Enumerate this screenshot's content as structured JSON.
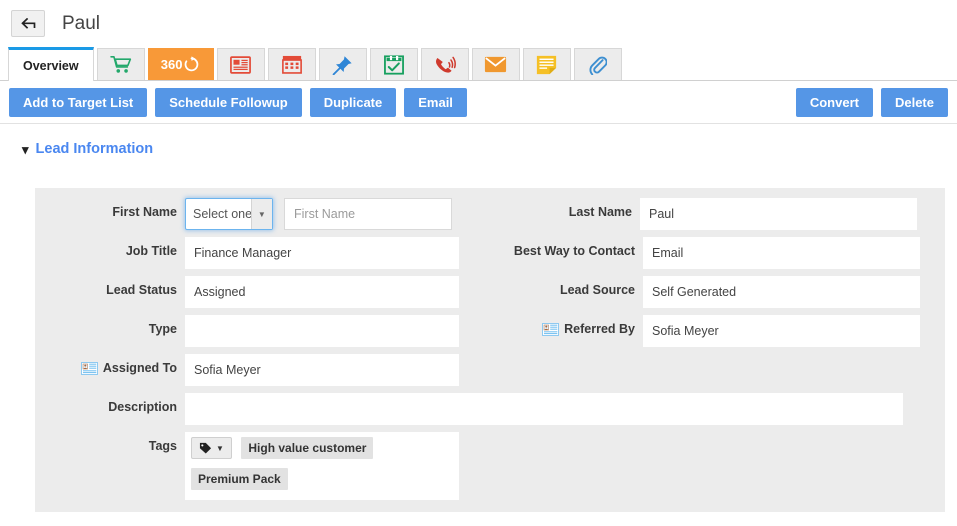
{
  "header": {
    "back_icon": "arrow-left-icon",
    "title": "Paul"
  },
  "tabs": [
    {
      "id": "overview",
      "label": "Overview",
      "icon": null,
      "active": true,
      "style": "text"
    },
    {
      "id": "cart",
      "label": "",
      "icon": "cart-icon",
      "active": false,
      "style": "icon"
    },
    {
      "id": "360",
      "label": "360",
      "icon": "refresh-360-icon",
      "active": false,
      "style": "orange"
    },
    {
      "id": "news",
      "label": "",
      "icon": "newspaper-icon",
      "active": false,
      "style": "icon"
    },
    {
      "id": "calendar",
      "label": "",
      "icon": "calendar-icon",
      "active": false,
      "style": "icon"
    },
    {
      "id": "pin",
      "label": "",
      "icon": "pushpin-icon",
      "active": false,
      "style": "icon"
    },
    {
      "id": "tasks",
      "label": "",
      "icon": "checklist-icon",
      "active": false,
      "style": "icon"
    },
    {
      "id": "calls",
      "label": "",
      "icon": "phone-icon",
      "active": false,
      "style": "icon"
    },
    {
      "id": "emails",
      "label": "",
      "icon": "envelope-icon",
      "active": false,
      "style": "icon"
    },
    {
      "id": "notes",
      "label": "",
      "icon": "note-icon",
      "active": false,
      "style": "icon"
    },
    {
      "id": "attachments",
      "label": "",
      "icon": "paperclip-icon",
      "active": false,
      "style": "icon"
    }
  ],
  "actions": {
    "left": [
      {
        "id": "add-to-target-list",
        "label": "Add to Target List"
      },
      {
        "id": "schedule-followup",
        "label": "Schedule Followup"
      },
      {
        "id": "duplicate",
        "label": "Duplicate"
      },
      {
        "id": "email",
        "label": "Email"
      }
    ],
    "right": [
      {
        "id": "convert",
        "label": "Convert"
      },
      {
        "id": "delete",
        "label": "Delete"
      }
    ]
  },
  "section": {
    "title": "Lead Information",
    "caret": "chevron-down-icon",
    "expanded": true
  },
  "form": {
    "first_name": {
      "label": "First Name",
      "salutation_value": "Select one",
      "salutation_focused": true,
      "value": "",
      "placeholder": "First Name"
    },
    "last_name": {
      "label": "Last Name",
      "value": "Paul"
    },
    "job_title": {
      "label": "Job Title",
      "value": "Finance Manager"
    },
    "best_way_contact": {
      "label": "Best Way to Contact",
      "value": "Email"
    },
    "lead_status": {
      "label": "Lead Status",
      "value": "Assigned"
    },
    "lead_source": {
      "label": "Lead Source",
      "value": "Self Generated"
    },
    "type": {
      "label": "Type",
      "value": ""
    },
    "referred_by": {
      "label": "Referred By",
      "value": "Sofia Meyer",
      "icon": "contact-card-icon"
    },
    "assigned_to": {
      "label": "Assigned To",
      "value": "Sofia Meyer",
      "icon": "contact-card-icon"
    },
    "description": {
      "label": "Description",
      "value": ""
    },
    "tags": {
      "label": "Tags",
      "dropdown_icon": "tag-icon",
      "dropdown_caret": "caret-down-icon",
      "chips": [
        "High value customer",
        "Premium Pack"
      ]
    }
  },
  "colors": {
    "accent_blue": "#5596e6",
    "link_blue": "#4a87f0",
    "tab_active_top": "#1a9ae6",
    "orange_tab": "#f89938",
    "panel_bg": "#ececec",
    "page_bg": "#ffffff"
  }
}
